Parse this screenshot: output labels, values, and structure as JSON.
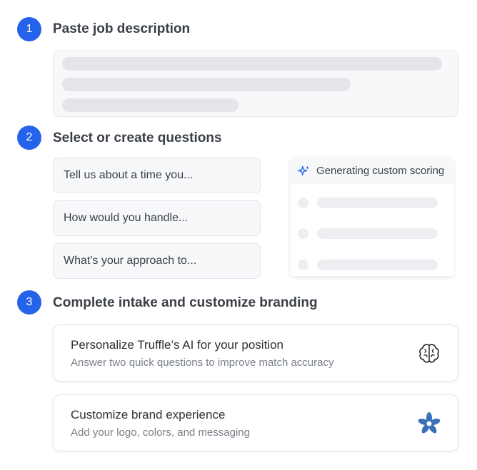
{
  "steps": [
    {
      "number": "1",
      "title": "Paste job description"
    },
    {
      "number": "2",
      "title": "Select or create questions"
    },
    {
      "number": "3",
      "title": "Complete intake and customize branding"
    }
  ],
  "questions": [
    "Tell us about a time you...",
    "How would you handle...",
    "What's your approach to..."
  ],
  "scoring_panel": {
    "title": "Generating custom scoring",
    "icon": "sparkle-icon"
  },
  "options": [
    {
      "title": "Personalize Truffle’s AI for your position",
      "subtitle": "Answer two quick questions to improve match accuracy",
      "icon": "brain-icon"
    },
    {
      "title": "Customize brand experience",
      "subtitle": "Add your logo, colors, and messaging",
      "icon": "pinwheel-icon"
    }
  ],
  "colors": {
    "accent": "#2563eb",
    "brand_icon": "#3b6fb6"
  }
}
